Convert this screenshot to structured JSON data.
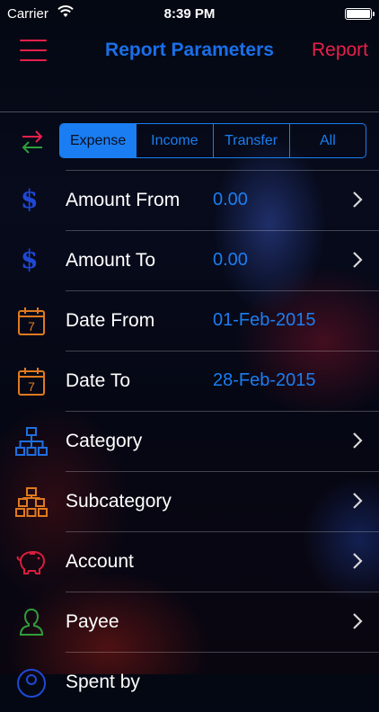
{
  "status": {
    "carrier": "Carrier",
    "time": "8:39 PM"
  },
  "nav": {
    "title": "Report Parameters",
    "right": "Report"
  },
  "segments": {
    "items": [
      "Expense",
      "Income",
      "Transfer",
      "All"
    ],
    "selected": "Expense"
  },
  "rows": [
    {
      "label": "Amount From",
      "value": "0.00",
      "icon": "dollar-icon",
      "icon_color": "#1f48d6"
    },
    {
      "label": "Amount To",
      "value": "0.00",
      "icon": "dollar-icon",
      "icon_color": "#1f48d6"
    },
    {
      "label": "Date From",
      "value": "01-Feb-2015",
      "icon": "calendar-icon",
      "icon_color": "#e07a1e",
      "icon_text": "7"
    },
    {
      "label": "Date To",
      "value": "28-Feb-2015",
      "icon": "calendar-icon",
      "icon_color": "#e07a1e",
      "icon_text": "7"
    },
    {
      "label": "Category",
      "value": "",
      "icon": "hierarchy-icon",
      "icon_color": "#1f6fe0"
    },
    {
      "label": "Subcategory",
      "value": "",
      "icon": "hierarchy-icon",
      "icon_color": "#e07a1e"
    },
    {
      "label": "Account",
      "value": "",
      "icon": "piggy-bank-icon",
      "icon_color": "#d81e3e"
    },
    {
      "label": "Payee",
      "value": "",
      "icon": "person-icon",
      "icon_color": "#2f9e3a"
    },
    {
      "label": "Spent by",
      "value": "",
      "icon": "person-circle-icon",
      "icon_color": "#1f48d6"
    }
  ],
  "colors": {
    "accent_blue": "#1a7ef2",
    "accent_red": "#e8204a"
  }
}
